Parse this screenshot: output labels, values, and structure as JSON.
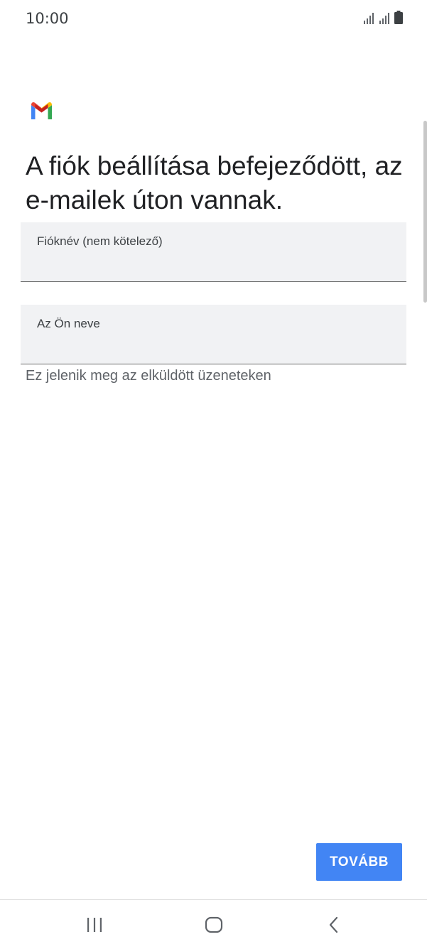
{
  "status_bar": {
    "time": "10:00",
    "icons": [
      "signal-icon",
      "signal-icon",
      "battery-icon"
    ]
  },
  "app": {
    "logo": "gmail-logo-icon",
    "title": "A fiók beállítása befejeződött, az e-mailek úton vannak."
  },
  "form": {
    "account_name_label": "Fióknév (nem kötelező)",
    "account_name_value": "",
    "your_name_label": "Az Ön neve",
    "your_name_value": "",
    "helper_text": "Ez jelenik meg az elküldött üzeneteken"
  },
  "actions": {
    "next_label": "TOVÁBB"
  },
  "colors": {
    "accent": "#4285f4",
    "field_bg": "#f1f2f4",
    "text": "#202124"
  },
  "nav_bar": {
    "icons": [
      "recents-icon",
      "home-icon",
      "back-icon"
    ]
  }
}
